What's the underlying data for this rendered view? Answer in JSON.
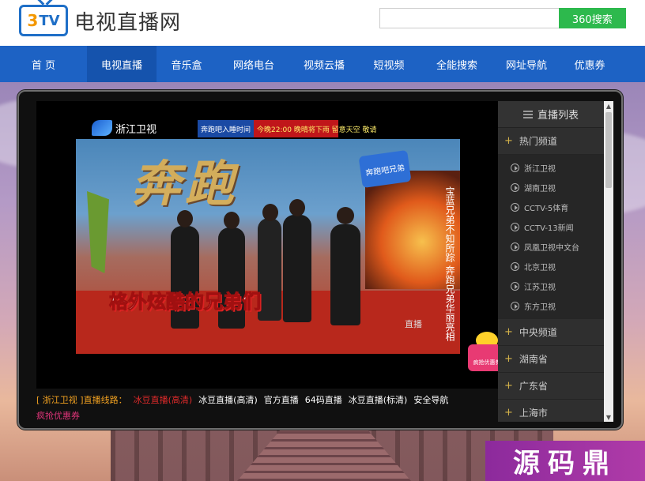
{
  "header": {
    "logo_mark": "3",
    "logo_tv": "TV",
    "site_name": "电视直播网",
    "search_placeholder": "",
    "search_button": "360搜索"
  },
  "nav": {
    "items": [
      {
        "label": "首 页"
      },
      {
        "label": "电视直播"
      },
      {
        "label": "音乐盒"
      },
      {
        "label": "网络电台"
      },
      {
        "label": "视频云播"
      },
      {
        "label": "短视频"
      },
      {
        "label": "全能搜索"
      },
      {
        "label": "网址导航"
      },
      {
        "label": "优惠券"
      }
    ],
    "active_index": 1
  },
  "video": {
    "channel_logo": "浙江卫视",
    "banner_left": "奔跑吧入睡时间",
    "banner_right": "今晚22:00 晚晴将下雨 留意天空 敬请",
    "show_logo": "奔跑吧兄弟",
    "big_title": "奔跑",
    "caption": "格外炫酷的兄弟们",
    "side_text": "宝蓝兄弟不知所踪 奔跑兄弟华丽亮相",
    "corner_tag": "直播",
    "promo_badge_label": "疯抢优惠券"
  },
  "channel_list": {
    "title": "直播列表",
    "groups": [
      {
        "name": "热门频道",
        "items": [
          "浙江卫视",
          "湖南卫视",
          "CCTV-5体育",
          "CCTV-13新闻",
          "凤凰卫视中文台",
          "北京卫视",
          "江苏卫视",
          "东方卫视"
        ]
      },
      {
        "name": "中央频道"
      },
      {
        "name": "湖南省"
      },
      {
        "name": "广东省"
      },
      {
        "name": "上海市"
      }
    ]
  },
  "lines": {
    "label": "[ 浙江卫视 ]直播线路：",
    "links": [
      "冰豆直播(高清)",
      "冰豆直播(高清)",
      "官方直播",
      "64码直播",
      "冰豆直播(标清)",
      "安全导航"
    ],
    "active_index": 0,
    "promo": "疯抢优惠券"
  },
  "watermark": "源码鼎",
  "colors": {
    "nav_bg": "#1d62c4",
    "search_btn": "#2db94d",
    "accent_orange": "#f0a020",
    "active_red": "#e02a2a"
  }
}
